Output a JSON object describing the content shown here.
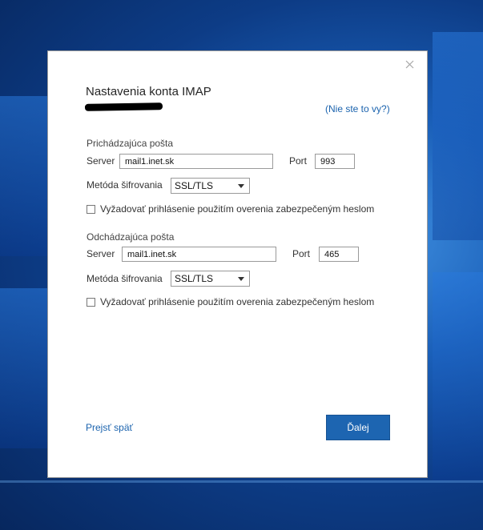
{
  "dialog": {
    "title": "Nastavenia konta IMAP",
    "not_you_link": "(Nie ste to vy?)",
    "incoming": {
      "heading": "Prichádzajúca pošta",
      "server_label": "Server",
      "server_value": "mail1.inet.sk",
      "port_label": "Port",
      "port_value": "993",
      "encryption_label": "Metóda šifrovania",
      "encryption_value": "SSL/TLS",
      "spa_label": "Vyžadovať prihlásenie použitím overenia zabezpečeným heslom"
    },
    "outgoing": {
      "heading": "Odchádzajúca pošta",
      "server_label": "Server",
      "server_value": "mail1.inet.sk",
      "port_label": "Port",
      "port_value": "465",
      "encryption_label": "Metóda šifrovania",
      "encryption_value": "SSL/TLS",
      "spa_label": "Vyžadovať prihlásenie použitím overenia zabezpečeným heslom"
    },
    "back_label": "Prejsť späť",
    "next_label": "Ďalej"
  },
  "colors": {
    "accent": "#1d65b1",
    "link": "#1b63ae",
    "desktop": "#0d3c86"
  }
}
